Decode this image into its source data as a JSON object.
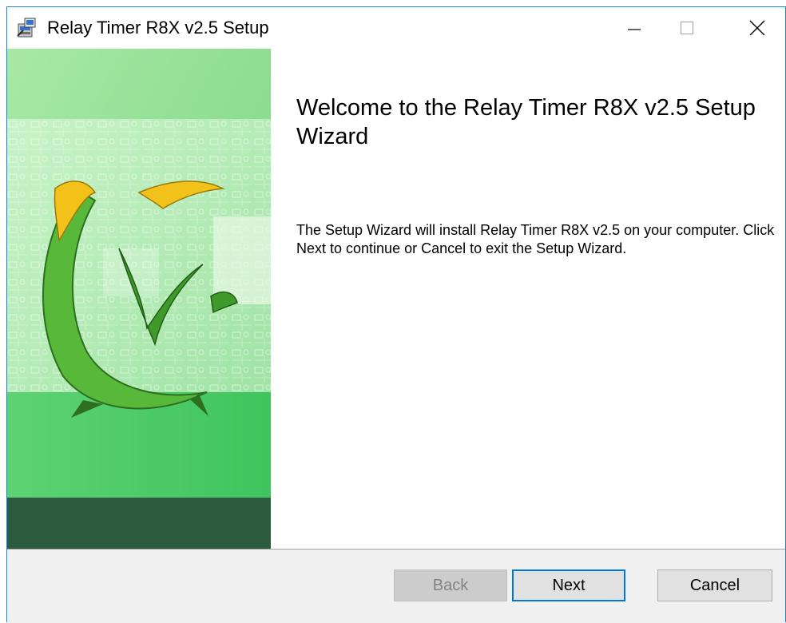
{
  "window": {
    "title": "Relay Timer R8X v2.5 Setup",
    "icon": "installer-icon",
    "controls": {
      "minimize_icon": "minimize-icon",
      "maximize_icon": "maximize-icon",
      "close_icon": "close-icon"
    },
    "accent_color": "#1883d7"
  },
  "welcome": {
    "heading": "Welcome to the Relay Timer R8X v2.5 Setup Wizard",
    "description": "The Setup Wizard will install Relay Timer R8X v2.5 on your computer. Click Next to continue or Cancel to exit the Setup Wizard."
  },
  "sidebar": {
    "image": "circuit-board-logo-banner",
    "colors": {
      "light_green": "#9be39a",
      "mid_green": "#4cc964",
      "dark_green": "#2a5a3c",
      "logo_yellow": "#f2c21a"
    }
  },
  "buttons": {
    "back_label": "Back",
    "next_label": "Next",
    "cancel_label": "Cancel",
    "back_enabled": false,
    "default_button": "Next"
  }
}
